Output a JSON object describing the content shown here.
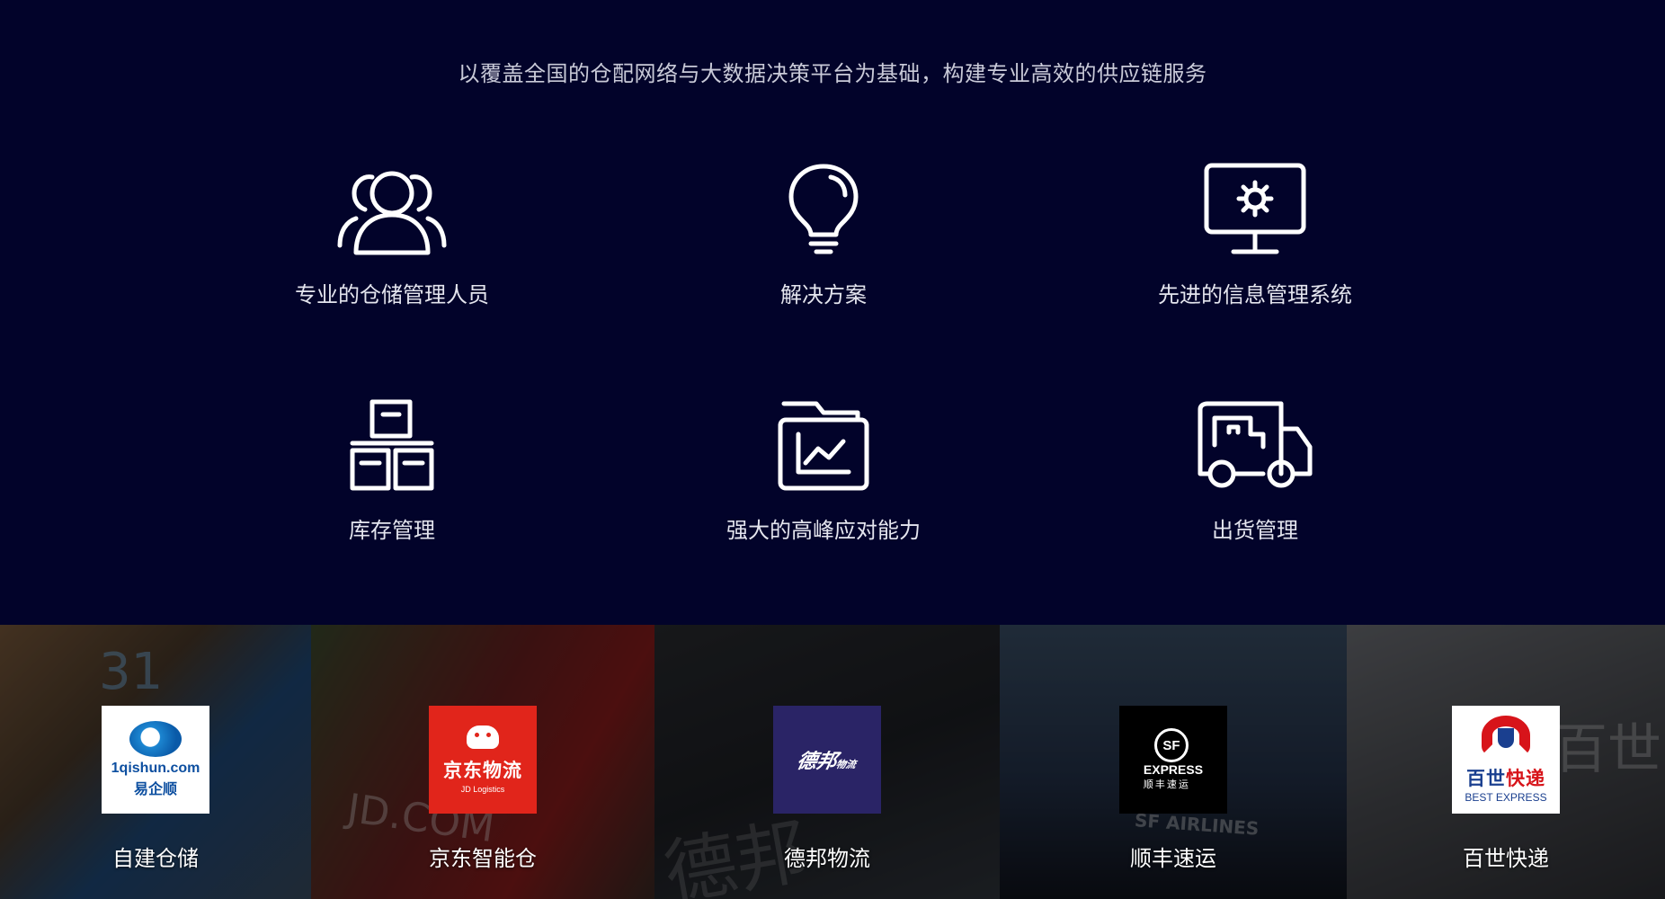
{
  "services": {
    "subtitle": "以覆盖全国的仓配网络与大数据决策平台为基础，构建专业高效的供应链服务",
    "features": [
      {
        "label": "专业的仓储管理人员",
        "icon": "users-icon"
      },
      {
        "label": "解决方案",
        "icon": "lightbulb-icon"
      },
      {
        "label": "先进的信息管理系统",
        "icon": "monitor-gear-icon"
      },
      {
        "label": "库存管理",
        "icon": "boxes-icon"
      },
      {
        "label": "强大的高峰应对能力",
        "icon": "folder-chart-icon"
      },
      {
        "label": "出货管理",
        "icon": "truck-icon"
      }
    ]
  },
  "partners": [
    {
      "name": "自建仓储",
      "logo_text": [
        "1qishun.com",
        "易企顺"
      ],
      "bg_text": "31"
    },
    {
      "name": "京东智能仓",
      "logo_text": [
        "京东物流",
        "JD Logistics"
      ],
      "bg_text": "JD.COM"
    },
    {
      "name": "德邦物流",
      "logo_text": [
        "德邦",
        "物流"
      ],
      "bg_text": "德邦"
    },
    {
      "name": "顺丰速运",
      "logo_text": [
        "SF",
        "EXPRESS",
        "顺丰速运"
      ],
      "bg_text": "SF AIRLINES"
    },
    {
      "name": "百世快递",
      "logo_text": [
        "百世",
        "快递",
        "BEST EXPRESS"
      ],
      "bg_text": "百世"
    }
  ],
  "colors": {
    "background": "#02032a",
    "jd_red": "#e1251b",
    "deppon_purple": "#2a2466",
    "best_red": "#d7141a",
    "best_blue": "#1a3f8f"
  }
}
